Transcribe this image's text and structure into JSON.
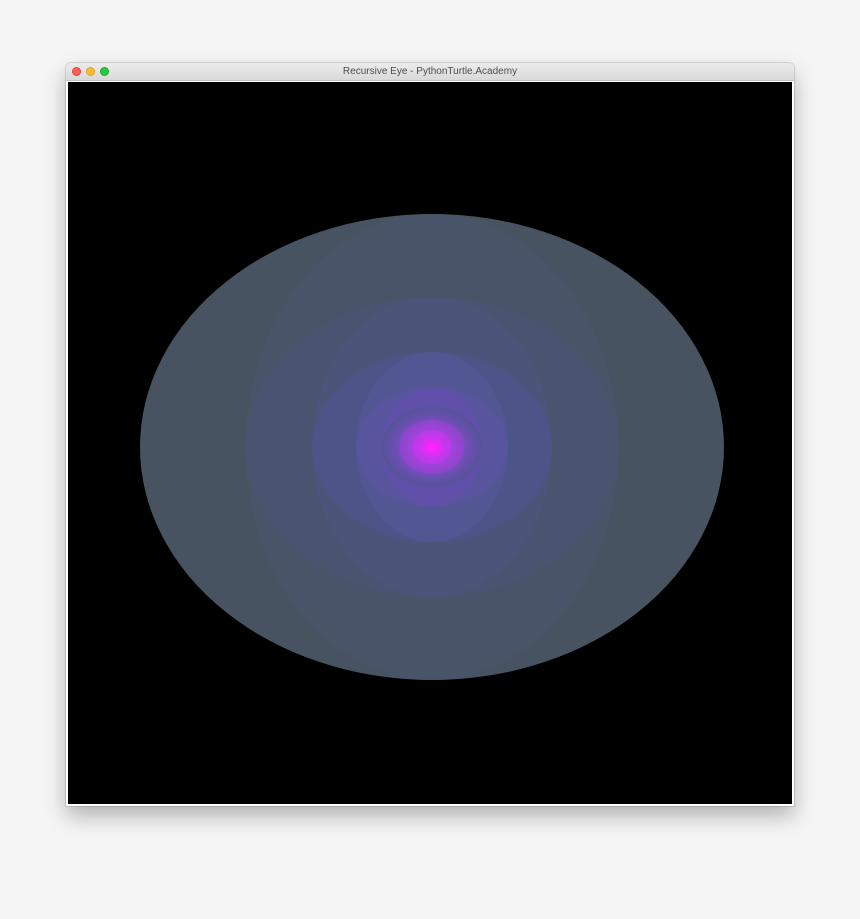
{
  "window": {
    "title": "Recursive Eye - PythonTurtle.Academy",
    "buttons": {
      "close": {
        "icon": "close-dot",
        "color": "#ff5f57"
      },
      "minimize": {
        "icon": "minimize-dot",
        "color": "#febc2e"
      },
      "maximize": {
        "icon": "maximize-dot",
        "color": "#28c840"
      }
    }
  },
  "canvas": {
    "background": "#000000",
    "colors": {
      "outer": "#475361",
      "mid": "#4a5470",
      "inner": "#4d5588",
      "core": "#7a4bc8",
      "center": "#ff22ff"
    }
  }
}
